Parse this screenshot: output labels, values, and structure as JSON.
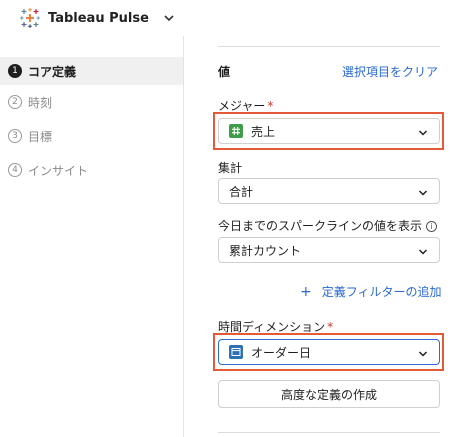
{
  "header": {
    "title": "Tableau Pulse",
    "logo_icon": "tableau-logo-icon",
    "menu_icon": "chevron-down-icon"
  },
  "sidebar": {
    "steps": [
      {
        "num": "1",
        "label": "コア定義",
        "active": true
      },
      {
        "num": "2",
        "label": "時刻",
        "active": false
      },
      {
        "num": "3",
        "label": "目標",
        "active": false
      },
      {
        "num": "4",
        "label": "インサイト",
        "active": false
      }
    ]
  },
  "main": {
    "section_title": "値",
    "clear_link": "選択項目をクリア",
    "measure": {
      "label": "メジャー",
      "required_mark": "*",
      "value": "売上",
      "icon": "measure-grid-icon"
    },
    "aggregation": {
      "label": "集計",
      "value": "合計"
    },
    "sparkline": {
      "label": "今日までのスパークラインの値を表示",
      "info_icon": "i",
      "value": "累計カウント"
    },
    "add_filter": {
      "icon": "+",
      "label": "定義フィルターの追加"
    },
    "time_dimension": {
      "label": "時間ディメンション",
      "required_mark": "*",
      "value": "オーダー日",
      "icon": "calendar-icon"
    },
    "advanced_button": "高度な定義の作成"
  },
  "colors": {
    "accent": "#2a6ad1",
    "highlight": "#e35a3b",
    "measure_icon": "#3f9c4a",
    "date_icon": "#2f6fb4"
  }
}
